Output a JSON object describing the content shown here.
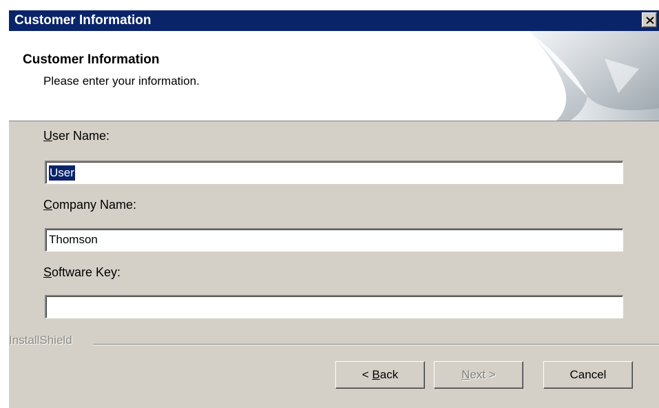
{
  "window": {
    "title": "Customer Information",
    "close_symbol": "×"
  },
  "header": {
    "title": "Customer Information",
    "subtitle": "Please enter your information."
  },
  "form": {
    "user_name": {
      "label_hotkey": "U",
      "label_rest": "ser Name:",
      "value": "User"
    },
    "company_name": {
      "label_hotkey": "C",
      "label_rest": "ompany Name:",
      "value": "Thomson"
    },
    "software_key": {
      "label_hotkey": "S",
      "label_rest": "oftware Key:",
      "value": ""
    }
  },
  "footer": {
    "brand": "InstallShield"
  },
  "buttons": {
    "back": {
      "prefix": "< ",
      "hotkey": "B",
      "rest": "ack",
      "enabled": true
    },
    "next": {
      "hotkey": "N",
      "rest": "ext >",
      "enabled": false
    },
    "cancel": {
      "label": "Cancel",
      "enabled": true
    }
  },
  "colors": {
    "titlebar": "#0a246a",
    "dialog_face": "#d4d0c8",
    "selection": "#0a246a"
  }
}
